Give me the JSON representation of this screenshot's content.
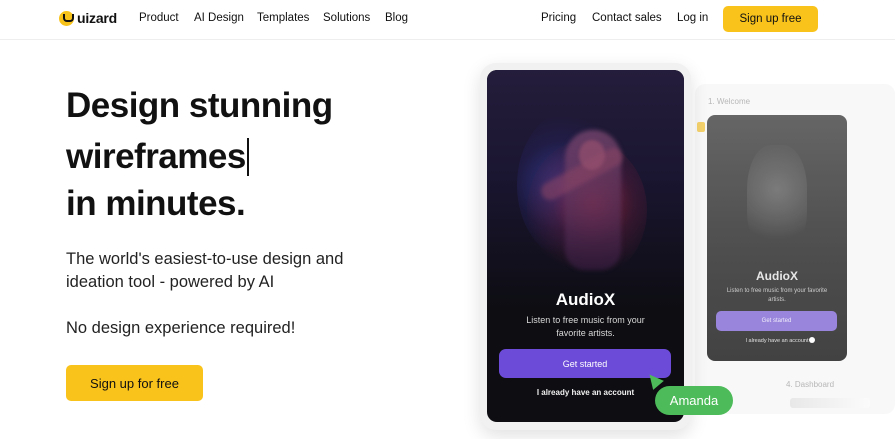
{
  "nav": {
    "logo_text": "uizard",
    "links": [
      "Product",
      "AI Design",
      "Templates",
      "Solutions",
      "Blog"
    ],
    "right_links": [
      "Pricing",
      "Contact sales",
      "Log in"
    ],
    "cta": "Sign up free"
  },
  "hero": {
    "title_line1": "Design stunning",
    "title_line2": "wireframes",
    "title_line3": "in minutes.",
    "subtitle_line1": "The world's easiest-to-use design and",
    "subtitle_line2": "ideation tool - powered by AI",
    "note": "No design experience required!",
    "cta": "Sign up for free"
  },
  "mockup": {
    "app_title": "AudioX",
    "app_subtitle": "Listen to free music from your favorite artists.",
    "primary_button": "Get started",
    "secondary_link": "I already have an account",
    "cursor_user": "Amanda",
    "colors": {
      "accent_purple": "#6c4bd8",
      "cursor_green": "#4dbb5a"
    }
  },
  "secondary_mockup": {
    "step1": "1. Welcome",
    "step4": "4. Dashboard",
    "app_title": "AudioX",
    "app_subtitle": "Listen to free music from your favorite artists.",
    "primary_button": "Get started",
    "secondary_link": "I already have an account"
  },
  "theme": {
    "brand_yellow": "#f9c31b",
    "text": "#111111"
  }
}
